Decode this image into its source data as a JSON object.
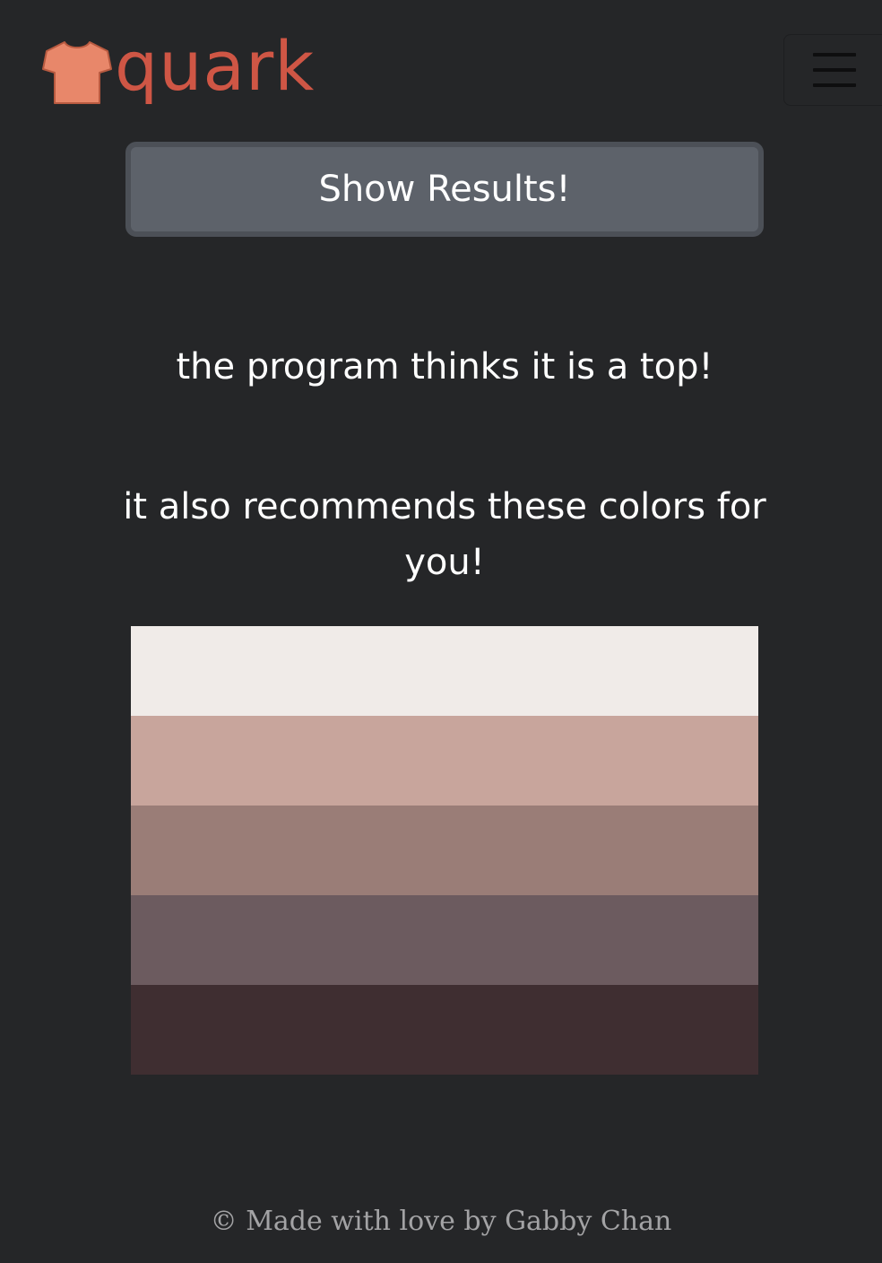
{
  "brand": {
    "name": "quark",
    "color": "#cf5645",
    "icon_color": "#e8876a",
    "icon": "tshirt-icon"
  },
  "navbar": {
    "menu_icon": "hamburger-menu-icon"
  },
  "show_button": {
    "label": "Show Results!"
  },
  "results": {
    "prediction": "the program thinks it is a top!",
    "recommendation": "it also recommends these colors for you!"
  },
  "palette": {
    "colors": [
      "#f0ebe8",
      "#c8a59c",
      "#9a7d77",
      "#6c5b5f",
      "#3f2e31"
    ]
  },
  "footer": {
    "text": "© Made with love by Gabby Chan"
  }
}
